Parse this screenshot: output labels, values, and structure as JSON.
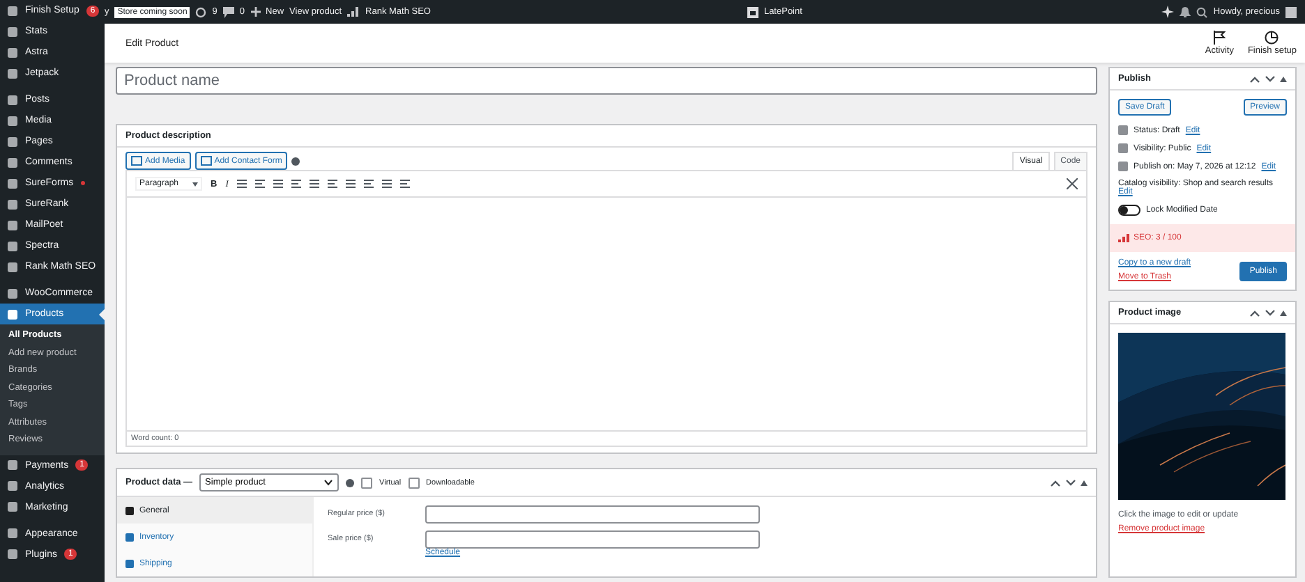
{
  "sidebar": {
    "groups": [
      {
        "items": [
          {
            "label": "Finish Setup",
            "badge": "6",
            "selected": false
          },
          {
            "label": "Stats",
            "selected": false
          },
          {
            "label": "Astra",
            "selected": false
          },
          {
            "label": "Jetpack",
            "selected": false
          }
        ]
      },
      {
        "items": [
          {
            "label": "Posts",
            "selected": false
          },
          {
            "label": "Media",
            "selected": false
          },
          {
            "label": "Pages",
            "selected": false
          },
          {
            "label": "Comments",
            "selected": false
          },
          {
            "label": "SureForms",
            "dot": true,
            "selected": false
          },
          {
            "label": "SureRank",
            "selected": false
          },
          {
            "label": "MailPoet",
            "selected": false
          },
          {
            "label": "Spectra",
            "selected": false
          },
          {
            "label": "Rank Math SEO",
            "selected": false
          }
        ]
      },
      {
        "items": [
          {
            "label": "WooCommerce",
            "selected": false
          },
          {
            "label": "Products",
            "selected": true,
            "children": [
              {
                "label": "All Products",
                "selected": true
              },
              {
                "label": "Add new product",
                "selected": false
              },
              {
                "label": "Brands",
                "selected": false
              },
              {
                "label": "Categories",
                "selected": false
              },
              {
                "label": "Tags",
                "selected": false
              },
              {
                "label": "Attributes",
                "selected": false
              },
              {
                "label": "Reviews",
                "selected": false
              }
            ]
          },
          {
            "label": "Payments",
            "badge": "1",
            "selected": false
          },
          {
            "label": "Analytics",
            "selected": false
          },
          {
            "label": "Marketing",
            "selected": false
          }
        ]
      },
      {
        "items": [
          {
            "label": "Appearance",
            "selected": false
          },
          {
            "label": "Plugins",
            "badge": "1",
            "selected": false
          }
        ]
      }
    ]
  },
  "admin_bar": {
    "cut_text": "y",
    "store_badge": "Store coming soon",
    "updates": "9",
    "comments": "0",
    "new": "New",
    "view": "View product",
    "rank_math": "Rank Math SEO",
    "latepoint": "LatePoint",
    "greeting": "Howdy, precious"
  },
  "header": {
    "title": "Edit Product",
    "actions": [
      "Activity",
      "Finish setup"
    ]
  },
  "product_name": {
    "placeholder": "Product name"
  },
  "description": {
    "title": "Product description",
    "media_buttons": [
      "Add Media",
      "Add Contact Form"
    ],
    "tabs": [
      {
        "label": "Visual",
        "selected": true
      },
      {
        "label": "Code",
        "selected": false
      }
    ],
    "format": "Paragraph",
    "bold": "B",
    "italic": "I",
    "word_count": "Word count: 0"
  },
  "product_data": {
    "title": "Product data —",
    "type": "Simple product",
    "checkboxes": [
      {
        "label": "Virtual",
        "checked": false
      },
      {
        "label": "Downloadable",
        "checked": false
      }
    ],
    "tabs": [
      {
        "label": "General",
        "selected": true
      },
      {
        "label": "Inventory",
        "selected": false
      },
      {
        "label": "Shipping",
        "selected": false
      }
    ],
    "fields": [
      {
        "label": "Regular price ($)"
      },
      {
        "label": "Sale price ($)",
        "link": "Schedule"
      }
    ]
  },
  "publish": {
    "title": "Publish",
    "save_draft": "Save Draft",
    "preview": "Preview",
    "rows": [
      {
        "text": "Status: Draft",
        "link": "Edit"
      },
      {
        "text": "Visibility: Public",
        "link": "Edit"
      },
      {
        "text": "Publish on: May 7, 2026 at 12:12",
        "link": "Edit"
      }
    ],
    "catalog": "Catalog visibility: Shop and search results",
    "catalog_link": "Edit",
    "lock": {
      "label": "Lock Modified Date",
      "on": false
    },
    "seo": "SEO: 3 / 100",
    "copy": "Copy to a new draft",
    "trash": "Move to Trash",
    "publish": "Publish"
  },
  "product_image": {
    "title": "Product image",
    "hint": "Click the image to edit or update",
    "remove": "Remove product image"
  }
}
